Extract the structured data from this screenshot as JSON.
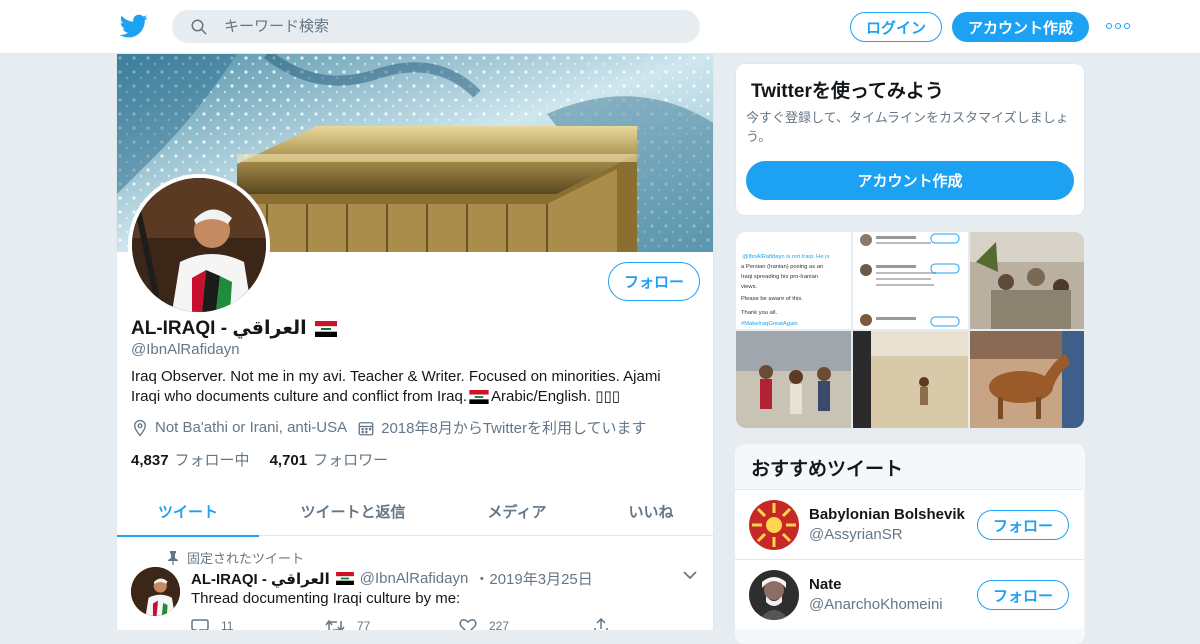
{
  "topbar": {
    "search_placeholder": "キーワード検索",
    "login_label": "ログイン",
    "signup_label": "アカウント作成"
  },
  "profile": {
    "name": "AL-IRAQI - العراقي",
    "flag_icon": "iraq-flag-icon",
    "handle": "@IbnAlRafidayn",
    "follow_label": "フォロー",
    "bio_line1": "Iraq Observer. Not me in my avi. Teacher & Writer. Focused on minorities. Ajami",
    "bio_line2a": "Iraqi who documents culture and conflict from Iraq.",
    "bio_line2b": " Arabic/English. ▯▯▯",
    "location": "Not Ba'athi or Irani, anti-USA",
    "joined": "2018年8月からTwitterを利用しています",
    "following_count": "4,837",
    "following_label": "フォロー中",
    "followers_count": "4,701",
    "followers_label": "フォロワー"
  },
  "tabs": [
    {
      "label": "ツイート",
      "active": true
    },
    {
      "label": "ツイートと返信",
      "active": false
    },
    {
      "label": "メディア",
      "active": false
    },
    {
      "label": "いいね",
      "active": false
    }
  ],
  "pinned_tweet": {
    "pinned_label": "固定されたツイート",
    "name": "AL-IRAQI - العراقي",
    "handle": "@IbnAlRafidayn",
    "separator": "・",
    "date": "2019年3月25日",
    "text": "Thread documenting Iraqi culture by me:",
    "replies": "11",
    "retweets": "77",
    "likes": "227"
  },
  "signup_card": {
    "title": "Twitterを使ってみよう",
    "desc": "今すぐ登録して、タイムラインをカスタマイズしましょう。",
    "button_label": "アカウント作成"
  },
  "suggested": {
    "title": "おすすめツイート",
    "users": [
      {
        "name": "Babylonian Bolshevik",
        "handle": "@AssyrianSR",
        "follow_label": "フォロー"
      },
      {
        "name": "Nate",
        "handle": "@AnarchoKhomeini",
        "follow_label": "フォロー"
      }
    ]
  },
  "media_tile_text": {
    "line1": ".@IbnAlRafidayn is not Iraqi. He is",
    "line2": "a Persian (Iranian) posing as an",
    "line3": "Iraqi spreading his pro-Iranian",
    "line4": "views.",
    "line5": "Please be aware of this.",
    "line6": "Thank you all.",
    "line7": "#MakeIraqGreatAgain"
  },
  "colors": {
    "accent": "#1da1f2",
    "muted": "#657786",
    "background": "#e6ecf0"
  }
}
